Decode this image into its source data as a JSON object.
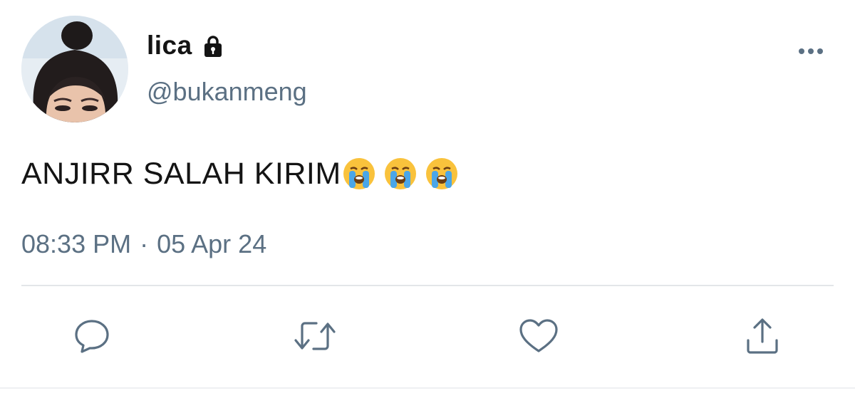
{
  "user": {
    "display_name": "lica",
    "handle": "@bukanmeng",
    "protected_icon": "lock-icon",
    "avatar_icon": "profile-photo"
  },
  "tweet": {
    "text": "ANJIRR SALAH KIRIM",
    "emojis": [
      "loudly-crying-face-emoji",
      "loudly-crying-face-emoji",
      "loudly-crying-face-emoji"
    ],
    "time": "08:33 PM",
    "separator": "·",
    "date": "05 Apr 24"
  },
  "actions": {
    "reply": "reply-icon",
    "retweet": "retweet-icon",
    "like": "heart-icon",
    "share": "share-icon",
    "more": "more-options-icon"
  },
  "colors": {
    "text": "#141414",
    "secondary": "#5b7083",
    "divider": "#e3e6e9",
    "emoji_face": "#f9c23c"
  }
}
